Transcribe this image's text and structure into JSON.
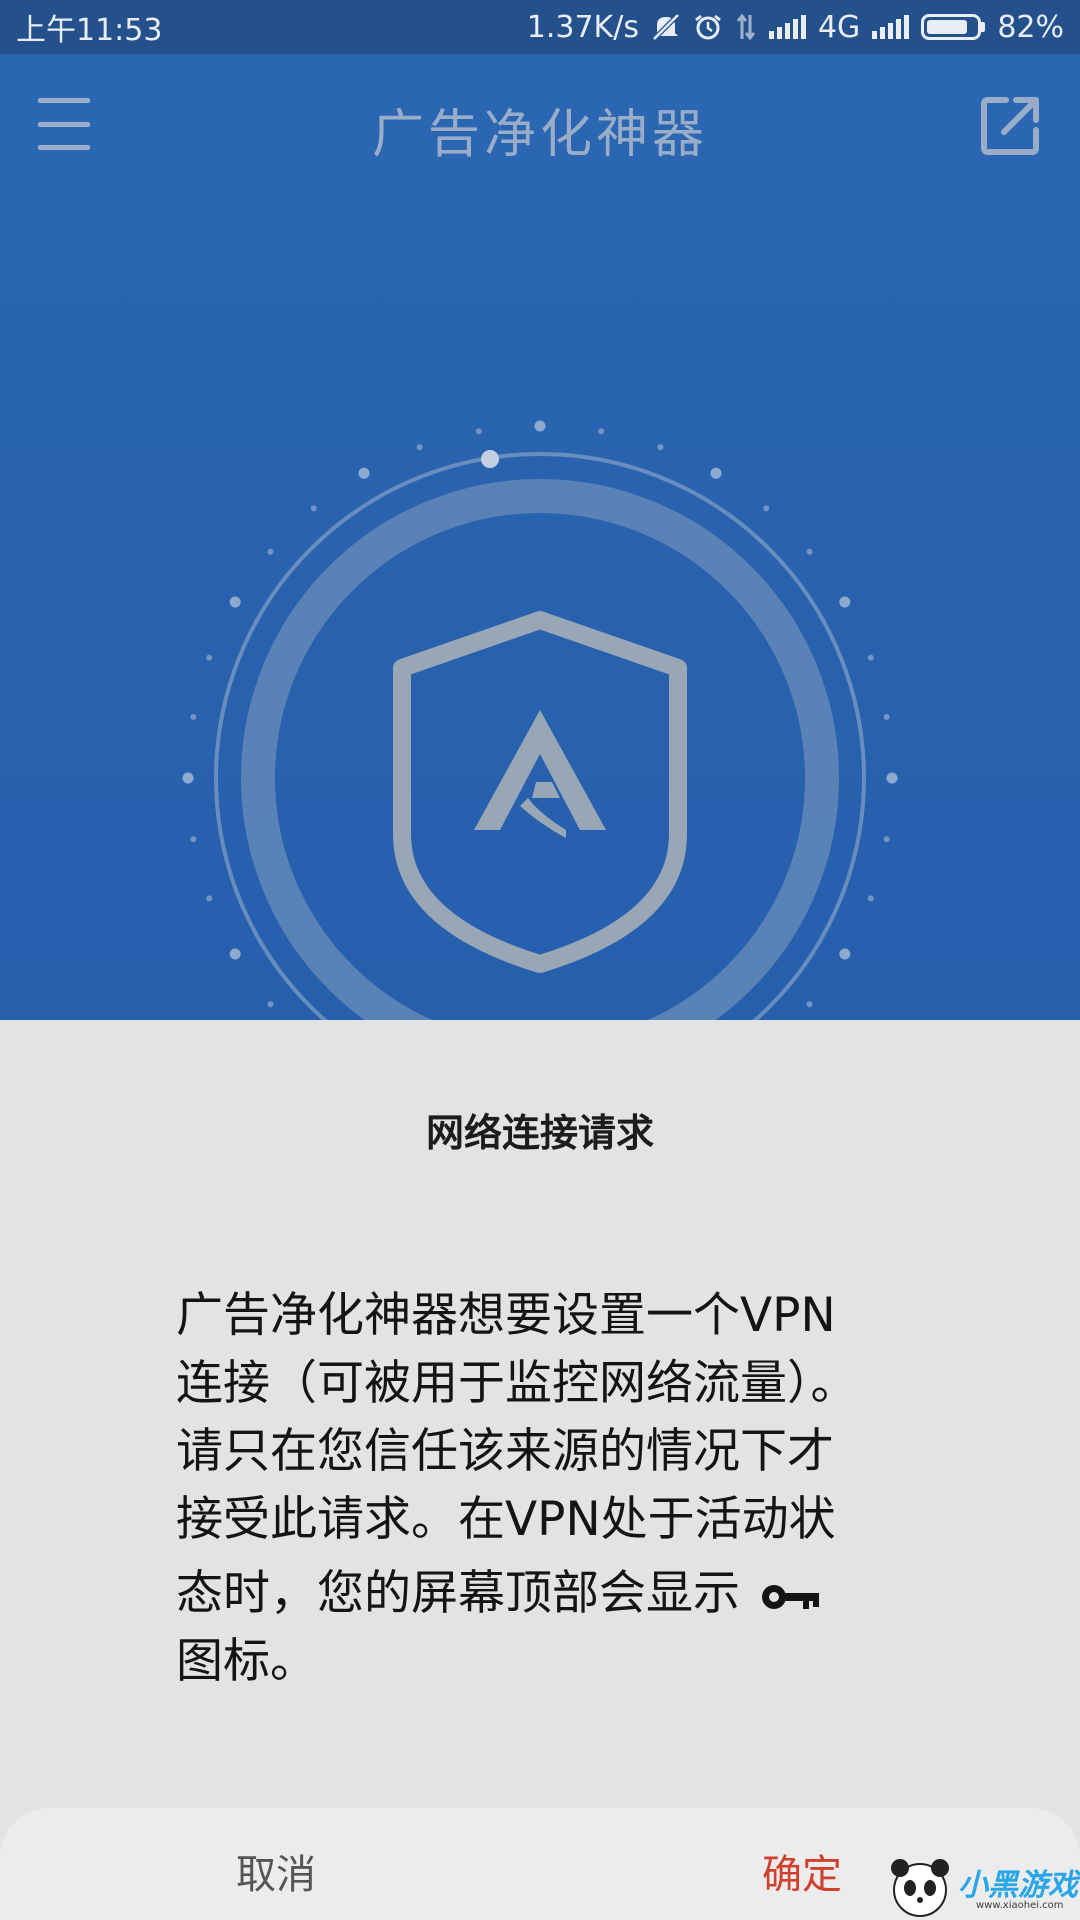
{
  "status_bar": {
    "time": "上午11:53",
    "net_speed": "1.37K/s",
    "network": "4G",
    "battery_percent": "82%",
    "battery_level": 0.82,
    "icons": [
      "mute-icon",
      "alarm-icon",
      "data-arrows-icon",
      "signal-icon",
      "signal-icon",
      "battery-icon"
    ]
  },
  "toolbar": {
    "title": "广告净化神器",
    "menu_icon": "hamburger-menu-icon",
    "share_icon": "external-link-icon"
  },
  "hero": {
    "logo_letter": "A",
    "icon": "shield-icon"
  },
  "dialog": {
    "title": "网络连接请求",
    "message_lines": [
      "广告净化神器想要设置一个VPN",
      "连接（可被用于监控网络流量）。",
      "请只在您信任该来源的情况下才",
      "接受此请求。在VPN处于活动状",
      "态时，您的屏幕顶部会显示",
      "图标。"
    ],
    "key_icon": "key-icon",
    "cancel_label": "取消",
    "confirm_label": "确定"
  },
  "watermark": {
    "text": "小黑游戏",
    "url": "www.xiaohei.com"
  },
  "colors": {
    "app_blue": "#2764b5",
    "status_bar": "#24508c",
    "dialog_bg": "#e3e3e3",
    "confirm_red": "#d0402e"
  }
}
